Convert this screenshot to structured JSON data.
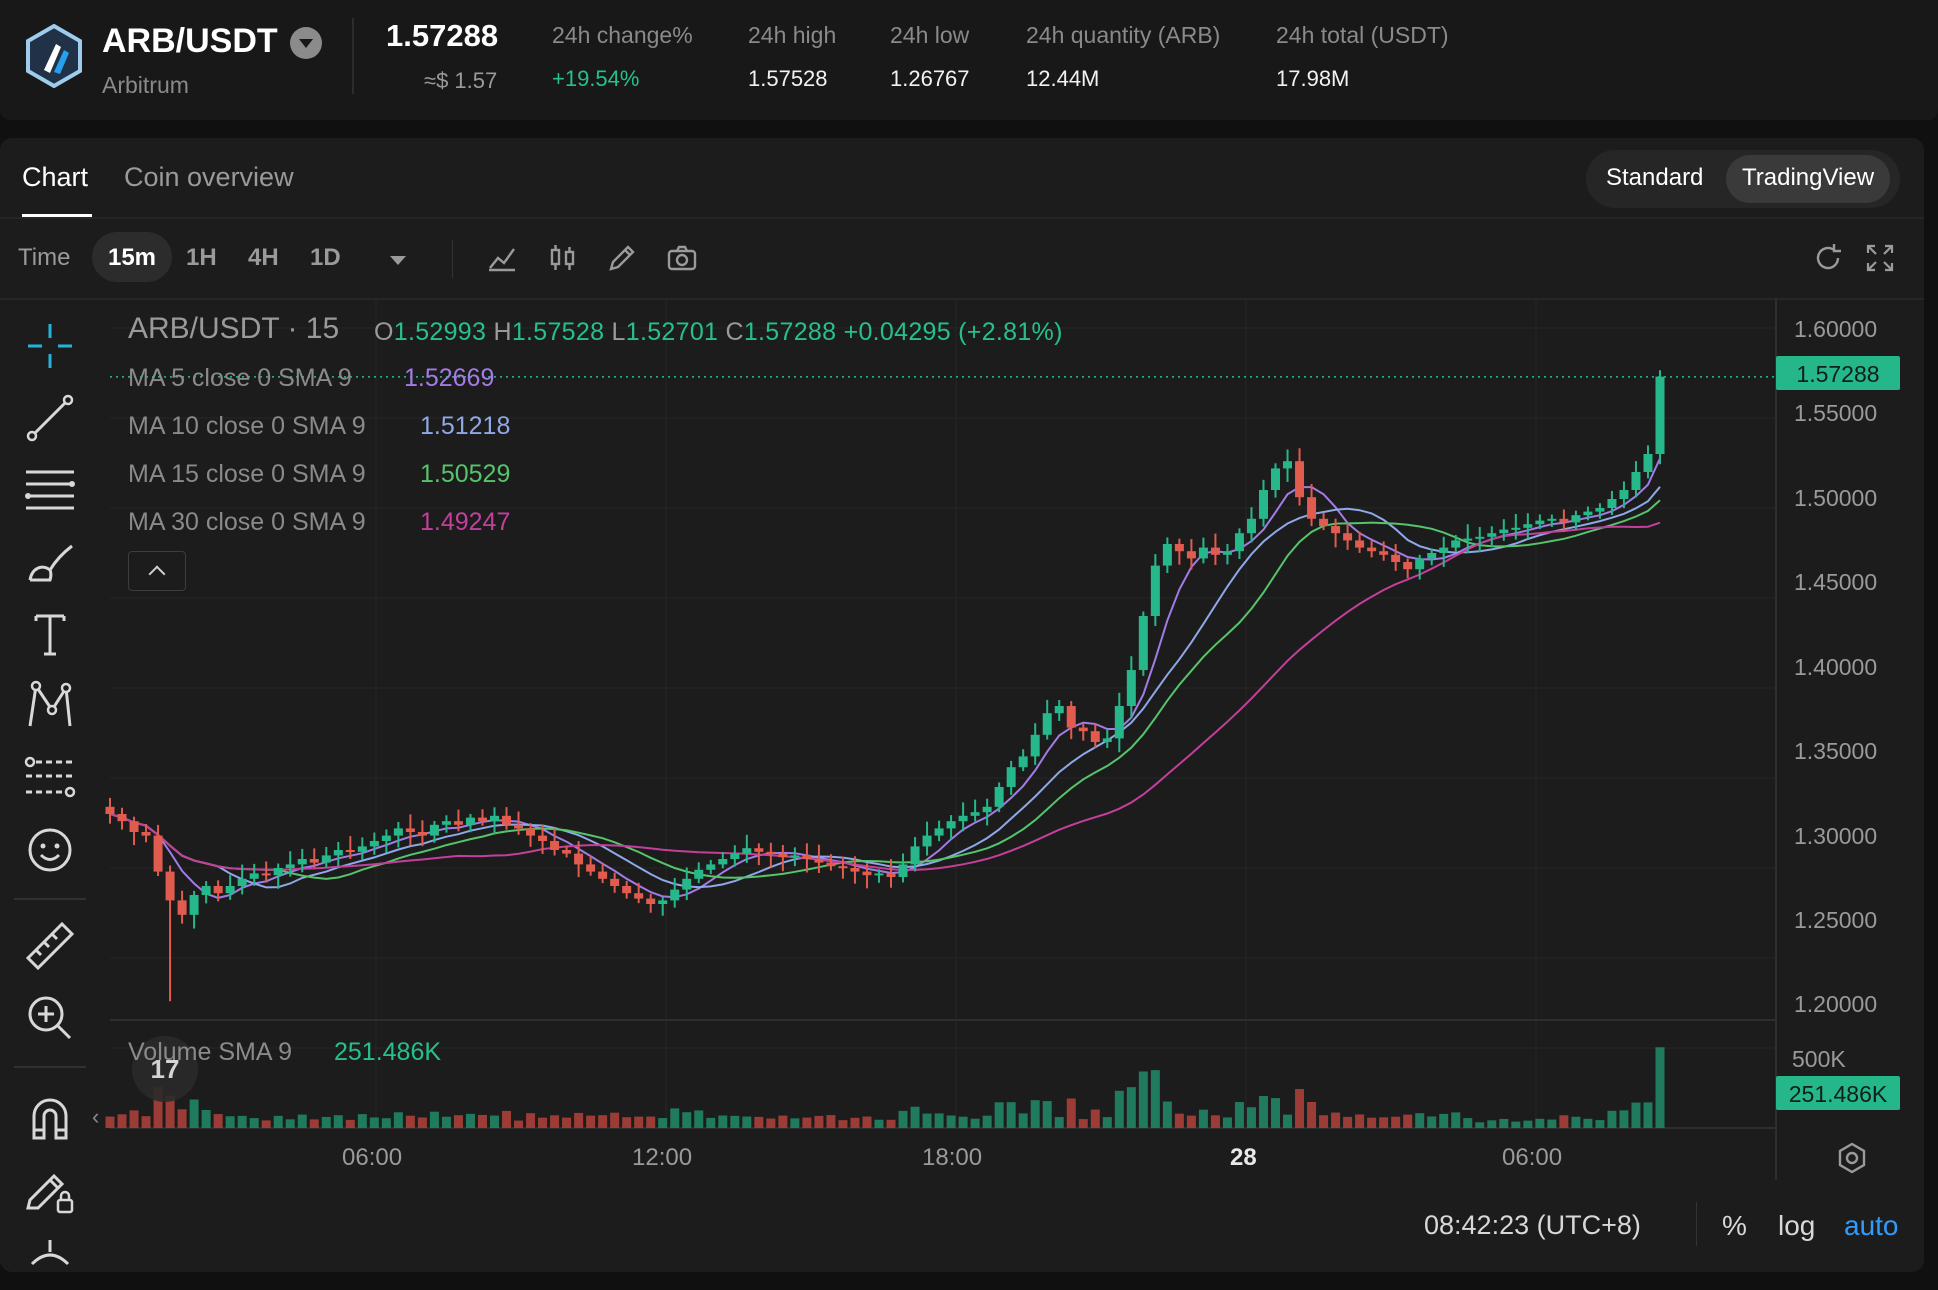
{
  "header": {
    "pair": "ARB/USDT",
    "coin_name": "Arbitrum",
    "last_price": "1.57288",
    "last_price_usd": "≈$ 1.57",
    "stats": [
      {
        "label": "24h change%",
        "value": "+19.54%",
        "trend": "up"
      },
      {
        "label": "24h high",
        "value": "1.57528"
      },
      {
        "label": "24h low",
        "value": "1.26767"
      },
      {
        "label": "24h quantity (ARB)",
        "value": "12.44M"
      },
      {
        "label": "24h total (USDT)",
        "value": "17.98M"
      }
    ]
  },
  "tabs": [
    "Chart",
    "Coin overview"
  ],
  "active_tab": "Chart",
  "view_modes": [
    "Standard",
    "TradingView"
  ],
  "active_view_mode": "TradingView",
  "toolbar": {
    "time_label": "Time",
    "timeframes": [
      "15m",
      "1H",
      "4H",
      "1D"
    ],
    "active_timeframe": "15m",
    "icons": [
      "indicators-icon",
      "candle-type-icon",
      "draw-icon",
      "screenshot-icon"
    ],
    "right_icons": [
      "reset-icon",
      "fullscreen-icon"
    ]
  },
  "left_tools": [
    "crosshair-icon",
    "trend-line-icon",
    "fib-icon",
    "brush-icon",
    "text-icon",
    "pattern-icon",
    "prediction-icon",
    "emoji-icon",
    "ruler-icon",
    "zoom-in-icon",
    "magnet-icon",
    "lock-draw-icon",
    "hide-icon"
  ],
  "legend": {
    "title": "ARB/USDT · 15",
    "o_label": "O",
    "o": "1.52993",
    "h_label": "H",
    "h": "1.57528",
    "l_label": "L",
    "l": "1.52701",
    "c_label": "C",
    "c": "1.57288",
    "change": "+0.04295 (+2.81%)",
    "ma": [
      {
        "label": "MA 5 close 0 SMA 9",
        "value": "1.52669",
        "color": "#a27ce6"
      },
      {
        "label": "MA 10 close 0 SMA 9",
        "value": "1.51218",
        "color": "#8fa8e8"
      },
      {
        "label": "MA 15 close 0 SMA 9",
        "value": "1.50529",
        "color": "#55c46a"
      },
      {
        "label": "MA 30 close 0 SMA 9",
        "value": "1.49247",
        "color": "#c43f9c"
      }
    ],
    "volume_label": "Volume SMA 9",
    "volume_value": "251.486K"
  },
  "price_axis": [
    "1.60000",
    "1.55000",
    "1.50000",
    "1.45000",
    "1.40000",
    "1.35000",
    "1.30000",
    "1.25000",
    "1.20000"
  ],
  "price_tag": "1.57288",
  "volume_axis": [
    "500K"
  ],
  "volume_tag": "251.486K",
  "time_axis": [
    "06:00",
    "12:00",
    "18:00",
    "28",
    "06:00"
  ],
  "bottom": {
    "clock": "08:42:23 (UTC+8)",
    "percent": "%",
    "log": "log",
    "auto": "auto"
  },
  "tv_badge": "17",
  "colors": {
    "up": "#26a17b",
    "down": "#e1574c",
    "accent": "#25c08e",
    "auto": "#2f9bff"
  },
  "chart_data": {
    "type": "candlestick",
    "title": "ARB/USDT · 15",
    "ylim": [
      1.2,
      1.6
    ],
    "price_series": [
      1.33,
      1.326,
      1.32,
      1.318,
      1.298,
      1.282,
      1.274,
      1.285,
      1.29,
      1.286,
      1.29,
      1.294,
      1.297,
      1.296,
      1.3,
      1.302,
      1.305,
      1.303,
      1.307,
      1.31,
      1.309,
      1.312,
      1.315,
      1.318,
      1.322,
      1.32,
      1.318,
      1.324,
      1.326,
      1.324,
      1.328,
      1.326,
      1.329,
      1.324,
      1.322,
      1.318,
      1.315,
      1.31,
      1.308,
      1.302,
      1.298,
      1.294,
      1.29,
      1.286,
      1.283,
      1.28,
      1.282,
      1.288,
      1.294,
      1.299,
      1.302,
      1.305,
      1.308,
      1.311,
      1.309,
      1.308,
      1.306,
      1.307,
      1.305,
      1.303,
      1.301,
      1.3,
      1.298,
      1.296,
      1.297,
      1.295,
      1.302,
      1.312,
      1.318,
      1.322,
      1.326,
      1.329,
      1.331,
      1.334,
      1.345,
      1.356,
      1.362,
      1.374,
      1.386,
      1.39,
      1.378,
      1.376,
      1.37,
      1.372,
      1.39,
      1.41,
      1.44,
      1.468,
      1.48,
      1.476,
      1.472,
      1.478,
      1.474,
      1.476,
      1.486,
      1.494,
      1.51,
      1.522,
      1.526,
      1.506,
      1.494,
      1.49,
      1.486,
      1.482,
      1.478,
      1.476,
      1.474,
      1.47,
      1.466,
      1.472,
      1.475,
      1.478,
      1.482,
      1.483,
      1.484,
      1.486,
      1.488,
      1.489,
      1.491,
      1.493,
      1.494,
      1.492,
      1.496,
      1.498,
      1.5,
      1.505,
      1.51,
      1.52,
      1.53,
      1.573
    ],
    "ma_series": [
      {
        "name": "MA 5",
        "last": 1.52669
      },
      {
        "name": "MA 10",
        "last": 1.51218
      },
      {
        "name": "MA 15",
        "last": 1.50529
      },
      {
        "name": "MA 30",
        "last": 1.49247
      }
    ],
    "volume_last": 251486,
    "volume_ylim": [
      0,
      500000
    ]
  }
}
